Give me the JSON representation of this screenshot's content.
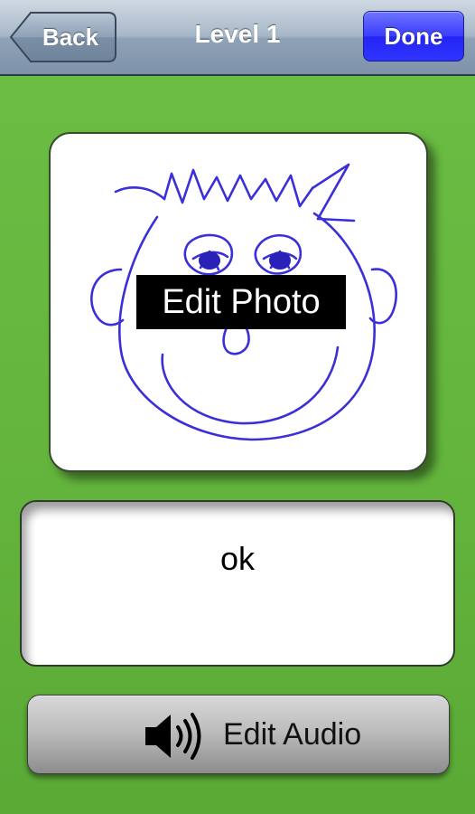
{
  "navbar": {
    "title": "Level 1",
    "back_label": "Back",
    "done_label": "Done"
  },
  "photo": {
    "edit_label": "Edit Photo",
    "image": "child-drawing-smiley-face"
  },
  "text_card": {
    "value": "ok"
  },
  "audio": {
    "edit_label": "Edit Audio",
    "icon": "speaker-icon"
  },
  "colors": {
    "background_green": "#63b43d",
    "done_blue": "#3a3dff",
    "navbar_steel": "#9fb0c2",
    "drawing_ink": "#3a2fd8"
  }
}
